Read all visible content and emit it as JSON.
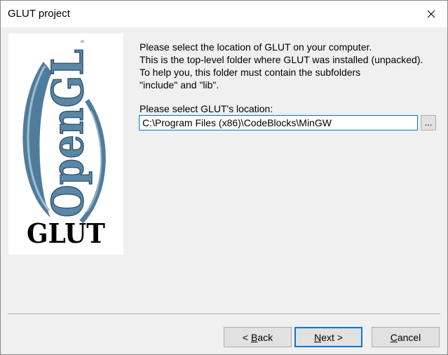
{
  "window": {
    "title": "GLUT project"
  },
  "icons": {
    "close": "close-icon"
  },
  "logo": {
    "brand_text": "OpenGL",
    "caption": "GLUT",
    "colors": {
      "logo_blue": "#5b87a6",
      "logo_dark": "#2d4f6a"
    }
  },
  "intro": {
    "lines": [
      "Please select the location of GLUT on your computer.",
      "This is the top-level folder where GLUT was installed (unpacked).",
      "To help you, this folder must contain the subfolders",
      "\"include\" and \"lib\"."
    ]
  },
  "location": {
    "label": "Please select GLUT's location:",
    "value": "C:\\Program Files (x86)\\CodeBlocks\\MinGW",
    "browse_label": "..."
  },
  "buttons": {
    "back": {
      "prefix": "< ",
      "mnemonic": "B",
      "rest": "ack"
    },
    "next": {
      "mnemonic": "N",
      "rest": "ext >"
    },
    "cancel": {
      "mnemonic": "C",
      "rest": "ancel"
    }
  },
  "colors": {
    "accent": "#0078d7",
    "face": "#f0f0f0",
    "button": "#e1e1e1"
  }
}
